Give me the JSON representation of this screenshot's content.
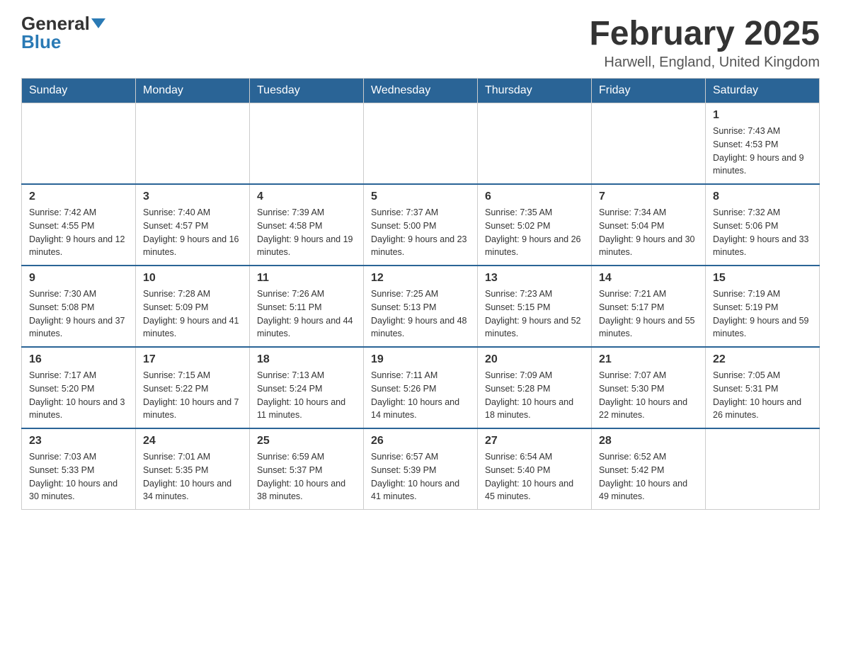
{
  "header": {
    "logo_general": "General",
    "logo_blue": "Blue",
    "month_title": "February 2025",
    "location": "Harwell, England, United Kingdom"
  },
  "days_of_week": [
    "Sunday",
    "Monday",
    "Tuesday",
    "Wednesday",
    "Thursday",
    "Friday",
    "Saturday"
  ],
  "weeks": [
    {
      "days": [
        {
          "num": "",
          "info": ""
        },
        {
          "num": "",
          "info": ""
        },
        {
          "num": "",
          "info": ""
        },
        {
          "num": "",
          "info": ""
        },
        {
          "num": "",
          "info": ""
        },
        {
          "num": "",
          "info": ""
        },
        {
          "num": "1",
          "info": "Sunrise: 7:43 AM\nSunset: 4:53 PM\nDaylight: 9 hours and 9 minutes."
        }
      ]
    },
    {
      "days": [
        {
          "num": "2",
          "info": "Sunrise: 7:42 AM\nSunset: 4:55 PM\nDaylight: 9 hours and 12 minutes."
        },
        {
          "num": "3",
          "info": "Sunrise: 7:40 AM\nSunset: 4:57 PM\nDaylight: 9 hours and 16 minutes."
        },
        {
          "num": "4",
          "info": "Sunrise: 7:39 AM\nSunset: 4:58 PM\nDaylight: 9 hours and 19 minutes."
        },
        {
          "num": "5",
          "info": "Sunrise: 7:37 AM\nSunset: 5:00 PM\nDaylight: 9 hours and 23 minutes."
        },
        {
          "num": "6",
          "info": "Sunrise: 7:35 AM\nSunset: 5:02 PM\nDaylight: 9 hours and 26 minutes."
        },
        {
          "num": "7",
          "info": "Sunrise: 7:34 AM\nSunset: 5:04 PM\nDaylight: 9 hours and 30 minutes."
        },
        {
          "num": "8",
          "info": "Sunrise: 7:32 AM\nSunset: 5:06 PM\nDaylight: 9 hours and 33 minutes."
        }
      ]
    },
    {
      "days": [
        {
          "num": "9",
          "info": "Sunrise: 7:30 AM\nSunset: 5:08 PM\nDaylight: 9 hours and 37 minutes."
        },
        {
          "num": "10",
          "info": "Sunrise: 7:28 AM\nSunset: 5:09 PM\nDaylight: 9 hours and 41 minutes."
        },
        {
          "num": "11",
          "info": "Sunrise: 7:26 AM\nSunset: 5:11 PM\nDaylight: 9 hours and 44 minutes."
        },
        {
          "num": "12",
          "info": "Sunrise: 7:25 AM\nSunset: 5:13 PM\nDaylight: 9 hours and 48 minutes."
        },
        {
          "num": "13",
          "info": "Sunrise: 7:23 AM\nSunset: 5:15 PM\nDaylight: 9 hours and 52 minutes."
        },
        {
          "num": "14",
          "info": "Sunrise: 7:21 AM\nSunset: 5:17 PM\nDaylight: 9 hours and 55 minutes."
        },
        {
          "num": "15",
          "info": "Sunrise: 7:19 AM\nSunset: 5:19 PM\nDaylight: 9 hours and 59 minutes."
        }
      ]
    },
    {
      "days": [
        {
          "num": "16",
          "info": "Sunrise: 7:17 AM\nSunset: 5:20 PM\nDaylight: 10 hours and 3 minutes."
        },
        {
          "num": "17",
          "info": "Sunrise: 7:15 AM\nSunset: 5:22 PM\nDaylight: 10 hours and 7 minutes."
        },
        {
          "num": "18",
          "info": "Sunrise: 7:13 AM\nSunset: 5:24 PM\nDaylight: 10 hours and 11 minutes."
        },
        {
          "num": "19",
          "info": "Sunrise: 7:11 AM\nSunset: 5:26 PM\nDaylight: 10 hours and 14 minutes."
        },
        {
          "num": "20",
          "info": "Sunrise: 7:09 AM\nSunset: 5:28 PM\nDaylight: 10 hours and 18 minutes."
        },
        {
          "num": "21",
          "info": "Sunrise: 7:07 AM\nSunset: 5:30 PM\nDaylight: 10 hours and 22 minutes."
        },
        {
          "num": "22",
          "info": "Sunrise: 7:05 AM\nSunset: 5:31 PM\nDaylight: 10 hours and 26 minutes."
        }
      ]
    },
    {
      "days": [
        {
          "num": "23",
          "info": "Sunrise: 7:03 AM\nSunset: 5:33 PM\nDaylight: 10 hours and 30 minutes."
        },
        {
          "num": "24",
          "info": "Sunrise: 7:01 AM\nSunset: 5:35 PM\nDaylight: 10 hours and 34 minutes."
        },
        {
          "num": "25",
          "info": "Sunrise: 6:59 AM\nSunset: 5:37 PM\nDaylight: 10 hours and 38 minutes."
        },
        {
          "num": "26",
          "info": "Sunrise: 6:57 AM\nSunset: 5:39 PM\nDaylight: 10 hours and 41 minutes."
        },
        {
          "num": "27",
          "info": "Sunrise: 6:54 AM\nSunset: 5:40 PM\nDaylight: 10 hours and 45 minutes."
        },
        {
          "num": "28",
          "info": "Sunrise: 6:52 AM\nSunset: 5:42 PM\nDaylight: 10 hours and 49 minutes."
        },
        {
          "num": "",
          "info": ""
        }
      ]
    }
  ]
}
